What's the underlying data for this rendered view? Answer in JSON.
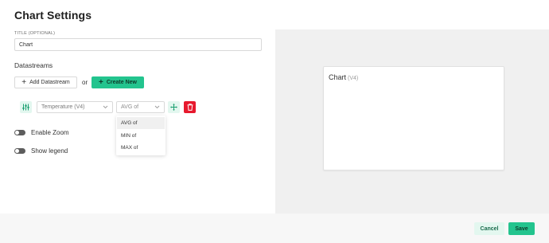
{
  "header": {
    "title": "Chart Settings"
  },
  "title_field": {
    "label": "TITLE (OPTIONAL)",
    "value": "Chart"
  },
  "datastreams": {
    "section_title": "Datastreams",
    "add_label": "Add Datastream",
    "or_text": "or",
    "create_label": "Create New",
    "row": {
      "datastream_value": "Temperature (V4)",
      "aggregation_value": "AVG of"
    },
    "aggregation_options": [
      "AVG of",
      "MIN of",
      "MAX of"
    ]
  },
  "toggles": {
    "zoom_label": "Enable Zoom",
    "legend_label": "Show legend"
  },
  "preview": {
    "title": "Chart",
    "subtitle": "(V4)"
  },
  "footer": {
    "cancel_label": "Cancel",
    "save_label": "Save"
  },
  "colors": {
    "accent": "#23c48e",
    "accent_light": "#e3f7ef",
    "danger": "#e7192e",
    "preview_bg": "#f0f0f0"
  },
  "icons": [
    "plus-icon",
    "tune-icon",
    "chevron-down-icon",
    "move-icon",
    "trash-icon"
  ]
}
